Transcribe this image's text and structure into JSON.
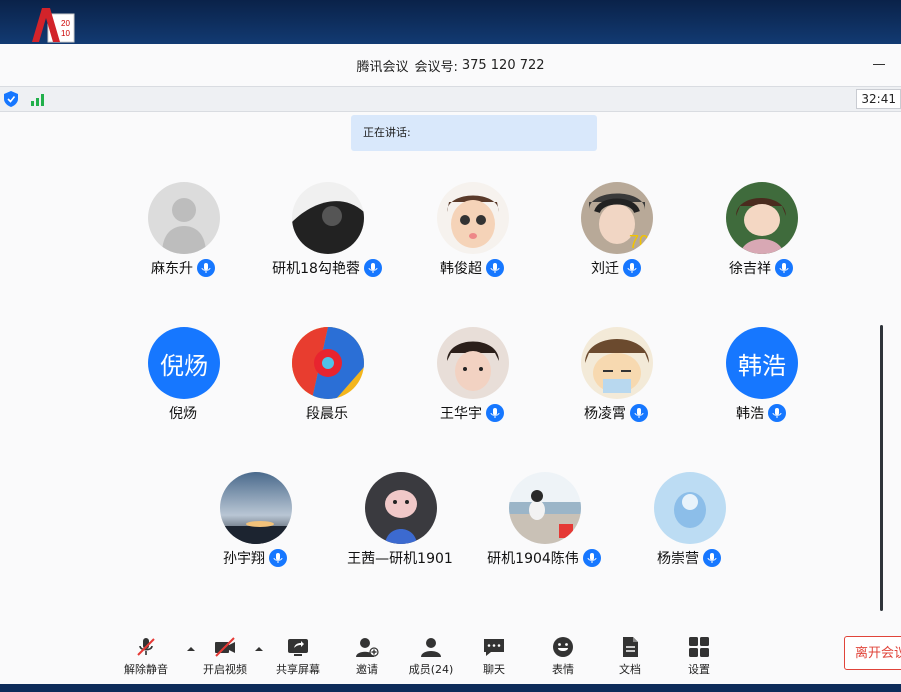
{
  "window": {
    "title": "腾讯会议",
    "meeting_id_label": "会议号:",
    "meeting_id": "375 120 722"
  },
  "status": {
    "timer": "32:41"
  },
  "speaking_label": "正在讲话:",
  "participants": [
    {
      "name": "麻东升",
      "avatar": "default-avatar-icon",
      "mic": true
    },
    {
      "name": "研机18勾艳蓉",
      "avatar": "photo",
      "mic": true
    },
    {
      "name": "韩俊超",
      "avatar": "cartoon",
      "mic": true
    },
    {
      "name": "刘迁",
      "avatar": "photo",
      "mic": true
    },
    {
      "name": "徐吉祥",
      "avatar": "cartoon",
      "mic": true
    },
    {
      "name": "倪炀",
      "avatar_text": "倪炀",
      "mic": false
    },
    {
      "name": "段晨乐",
      "avatar": "photo",
      "mic": false
    },
    {
      "name": "王华宇",
      "avatar": "photo",
      "mic": true
    },
    {
      "name": "杨凌霄",
      "avatar": "cartoon",
      "mic": true
    },
    {
      "name": "韩浩",
      "avatar_text": "韩浩",
      "mic": true
    },
    {
      "name": "孙宇翔",
      "avatar": "photo",
      "mic": true
    },
    {
      "name": "王茜—研机1901",
      "avatar": "photo",
      "mic": false
    },
    {
      "name": "研机1904陈伟",
      "avatar": "photo",
      "mic": true
    },
    {
      "name": "杨崇营",
      "avatar": "photo",
      "mic": true
    }
  ],
  "toolbar": {
    "unmute": "解除静音",
    "start_video": "开启视频",
    "share_screen": "共享屏幕",
    "invite": "邀请",
    "members": "成员(24)",
    "chat": "聊天",
    "emoji": "表情",
    "docs": "文档",
    "settings": "设置",
    "leave": "离开会议"
  },
  "colors": {
    "accent": "#1677ff",
    "leave": "#e0443a"
  }
}
